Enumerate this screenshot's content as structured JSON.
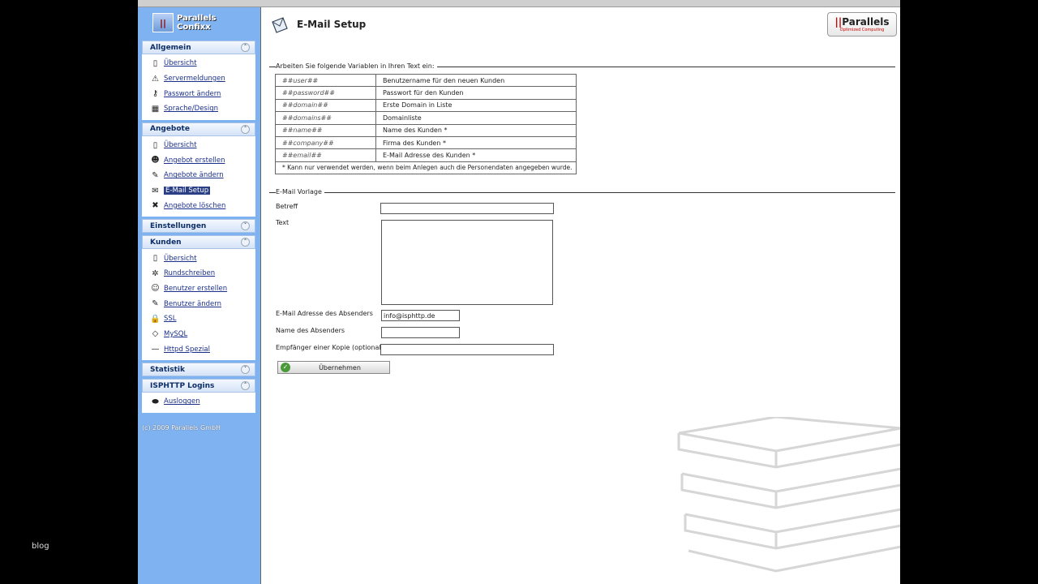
{
  "watermark": "blog",
  "app": {
    "logo_line1": "Parallels",
    "logo_line2": "Confixx",
    "brand_name": "Parallels",
    "brand_tag": "Optimized Computing"
  },
  "sidebar": {
    "sections": [
      {
        "title": "Allgemein",
        "expanded": true,
        "items": [
          "Übersicht",
          "Servermeldungen",
          "Passwort ändern",
          "Sprache/Design"
        ],
        "icons": [
          "page-icon",
          "warning-icon",
          "key-icon",
          "palette-icon"
        ]
      },
      {
        "title": "Angebote",
        "expanded": true,
        "items": [
          "Übersicht",
          "Angebot erstellen",
          "Angebote ändern",
          "E-Mail Setup",
          "Angebote löschen"
        ],
        "icons": [
          "page-icon",
          "user-add-icon",
          "edit-icon",
          "mail-icon",
          "delete-icon"
        ],
        "active_index": 3
      },
      {
        "title": "Einstellungen",
        "expanded": false,
        "items": []
      },
      {
        "title": "Kunden",
        "expanded": true,
        "items": [
          "Übersicht",
          "Rundschreiben",
          "Benutzer erstellen",
          "Benutzer ändern",
          "SSL",
          "MySQL",
          "Httpd Spezial"
        ],
        "icons": [
          "page-icon",
          "gear-icon",
          "user-icon",
          "edit-icon",
          "lock-icon",
          "database-icon",
          "wrench-icon"
        ]
      },
      {
        "title": "Statistik",
        "expanded": false,
        "items": []
      },
      {
        "title": "ISPHTTP Logins",
        "expanded": true,
        "items": [
          "Ausloggen"
        ],
        "icons": [
          "logout-icon"
        ]
      }
    ],
    "copyright": "(c) 2009 Parallels GmbH"
  },
  "main": {
    "page_title": "E-Mail Setup",
    "legend1": "Arbeiten Sie folgende Variablen in Ihren Text ein:",
    "variables": [
      {
        "var": "##user##",
        "desc": "Benutzername für den neuen Kunden"
      },
      {
        "var": "##password##",
        "desc": "Passwort für den Kunden"
      },
      {
        "var": "##domain##",
        "desc": "Erste Domain in Liste"
      },
      {
        "var": "##domains##",
        "desc": "Domainliste"
      },
      {
        "var": "##name##",
        "desc": "Name des Kunden *"
      },
      {
        "var": "##company##",
        "desc": "Firma des Kunden *"
      },
      {
        "var": "##email##",
        "desc": "E-Mail Adresse des Kunden *"
      }
    ],
    "variables_note": "* Kann nur verwendet werden, wenn beim Anlegen auch die Personendaten angegeben wurde.",
    "legend2": "E-Mail Vorlage",
    "form": {
      "subject_label": "Betreff",
      "subject_value": "",
      "text_label": "Text",
      "text_value": "",
      "sender_email_label": "E-Mail Adresse des Absenders",
      "sender_email_value": "info@isphttp.de",
      "sender_name_label": "Name des Absenders",
      "sender_name_value": "",
      "cc_label": "Empfänger einer Kopie (optional)",
      "cc_value": "",
      "submit_label": "Übernehmen"
    }
  }
}
